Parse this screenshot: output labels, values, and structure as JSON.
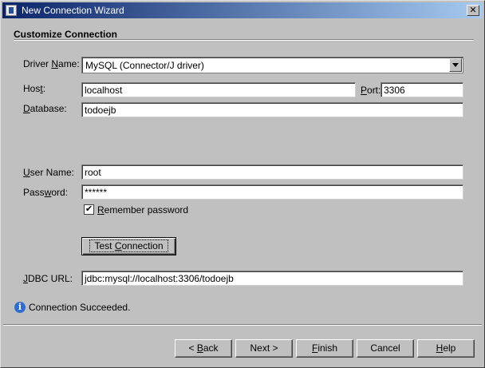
{
  "window": {
    "title": "New Connection Wizard",
    "close_glyph": "✕"
  },
  "section": {
    "title": "Customize Connection"
  },
  "form": {
    "driver": {
      "label_pre": "Driver ",
      "label_mn": "N",
      "label_post": "ame:",
      "value": "MySQL (Connector/J driver)"
    },
    "host": {
      "label_pre": "Hos",
      "label_mn": "t",
      "label_post": ":",
      "value": "localhost"
    },
    "port": {
      "label_pre": "",
      "label_mn": "P",
      "label_post": "ort:",
      "value": "3306"
    },
    "database": {
      "label_pre": "",
      "label_mn": "D",
      "label_post": "atabase:",
      "value": "todoejb"
    },
    "user": {
      "label_pre": "",
      "label_mn": "U",
      "label_post": "ser Name:",
      "value": "root"
    },
    "password": {
      "label_pre": "Pass",
      "label_mn": "w",
      "label_post": "ord:",
      "value": "******"
    },
    "remember": {
      "label_pre": "",
      "label_mn": "R",
      "label_post": "emember password",
      "checked": true,
      "check_glyph": "✔"
    },
    "test_button": {
      "label_pre": "Test ",
      "label_mn": "C",
      "label_post": "onnection"
    },
    "jdbc": {
      "label_pre": "",
      "label_mn": "J",
      "label_post": "DBC URL:",
      "value": "jdbc:mysql://localhost:3306/todoejb"
    }
  },
  "status": {
    "icon": "info-icon",
    "icon_glyph": "i",
    "text": "Connection Succeeded."
  },
  "buttons": {
    "back": {
      "label_pre": "< ",
      "label_mn": "B",
      "label_post": "ack"
    },
    "next": {
      "label": "Next >"
    },
    "finish": {
      "label_pre": "",
      "label_mn": "F",
      "label_post": "inish"
    },
    "cancel": {
      "label": "Cancel"
    },
    "help": {
      "label_pre": "",
      "label_mn": "H",
      "label_post": "elp"
    }
  }
}
